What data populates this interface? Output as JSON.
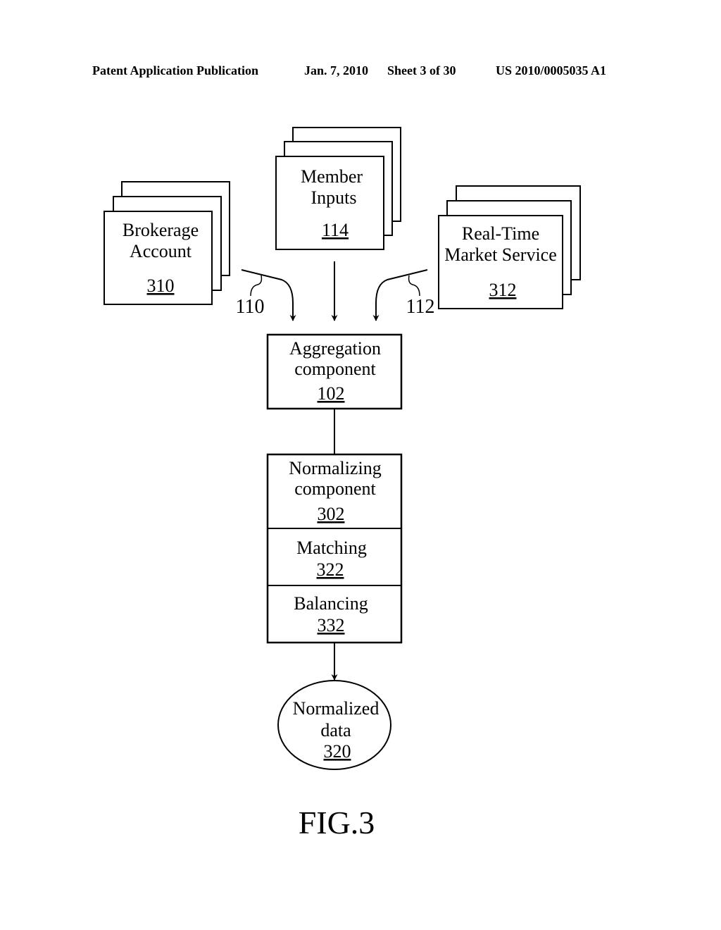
{
  "header": {
    "publication": "Patent Application Publication",
    "date": "Jan. 7, 2010",
    "sheet": "Sheet 3 of 30",
    "number": "US 2010/0005035 A1"
  },
  "diagram": {
    "sources": [
      {
        "id": "brokerage",
        "line1": "Brokerage",
        "line2": "Account",
        "ref": "310"
      },
      {
        "id": "member",
        "line1": "Member",
        "line2": "Inputs",
        "ref": "114"
      },
      {
        "id": "market",
        "line1": "Real-Time",
        "line2": "Market Service",
        "ref": "312"
      }
    ],
    "connector_labels": {
      "left": "110",
      "right": "112"
    },
    "aggregation": {
      "line1": "Aggregation",
      "line2": "component",
      "ref": "102"
    },
    "normalizing": {
      "line1": "Normalizing",
      "line2": "component",
      "ref": "302"
    },
    "matching": {
      "label": "Matching",
      "ref": "322"
    },
    "balancing": {
      "label": "Balancing",
      "ref": "332"
    },
    "output": {
      "line1": "Normalized",
      "line2": "data",
      "ref": "320"
    },
    "figure_label": "FIG.3"
  }
}
